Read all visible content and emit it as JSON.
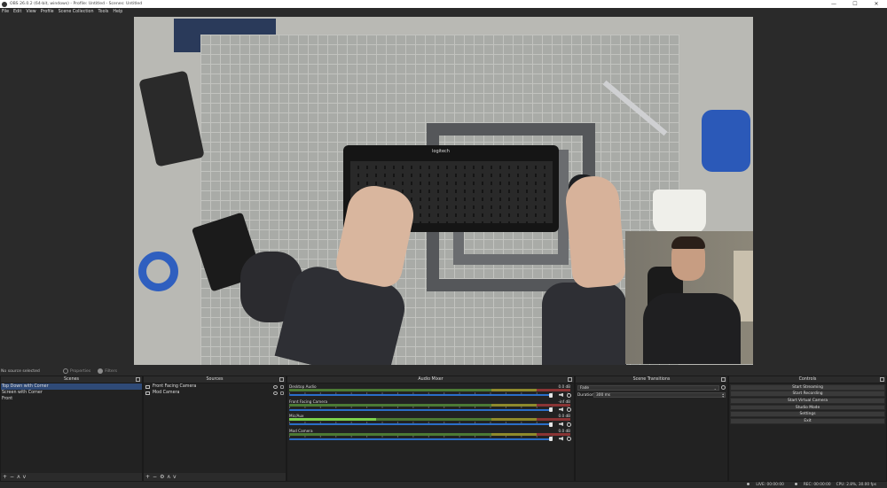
{
  "window": {
    "title": "OBS 26.0.2 (64-bit, windows) - Profile: Untitled - Scenes: Untitled",
    "minimize": "—",
    "maximize": "☐",
    "close": "✕"
  },
  "menu": [
    "File",
    "Edit",
    "View",
    "Profile",
    "Scene Collection",
    "Tools",
    "Help"
  ],
  "preview": {
    "keyboard_brand": "logitech"
  },
  "toolbar": {
    "no_source": "No source selected",
    "properties": "Properties",
    "filters": "Filters"
  },
  "docks": {
    "scenes": {
      "title": "Scenes",
      "items": [
        "Top Down with Corner",
        "Screen with Corner",
        "Front"
      ],
      "selected_index": 0
    },
    "sources": {
      "title": "Sources",
      "items": [
        "Front Facing Camera",
        "Mod Camera"
      ]
    },
    "mixer": {
      "title": "Audio Mixer",
      "channels": [
        {
          "name": "Desktop Audio",
          "db": "0.0 dB",
          "level": 0.0
        },
        {
          "name": "Front Facing Camera",
          "db": "-inf dB",
          "level": 0.0
        },
        {
          "name": "Mic/Aux",
          "db": "0.0 dB",
          "level": 0.31
        },
        {
          "name": "Mod Camera",
          "db": "0.0 dB",
          "level": 0.0
        }
      ]
    },
    "transitions": {
      "title": "Scene Transitions",
      "selected": "Fade",
      "duration_label": "Duration",
      "duration_value": "300 ms"
    },
    "controls": {
      "title": "Controls",
      "buttons": [
        "Start Streaming",
        "Start Recording",
        "Start Virtual Camera",
        "Studio Mode",
        "Settings",
        "Exit"
      ]
    }
  },
  "footer_icons": {
    "add": "+",
    "remove": "−",
    "up": "ʌ",
    "down": "v",
    "settings": "⚙"
  },
  "status": {
    "live": "LIVE: 00:00:00",
    "rec": "REC: 00:00:00",
    "cpu": "CPU: 2.8%, 30.00 fps"
  }
}
